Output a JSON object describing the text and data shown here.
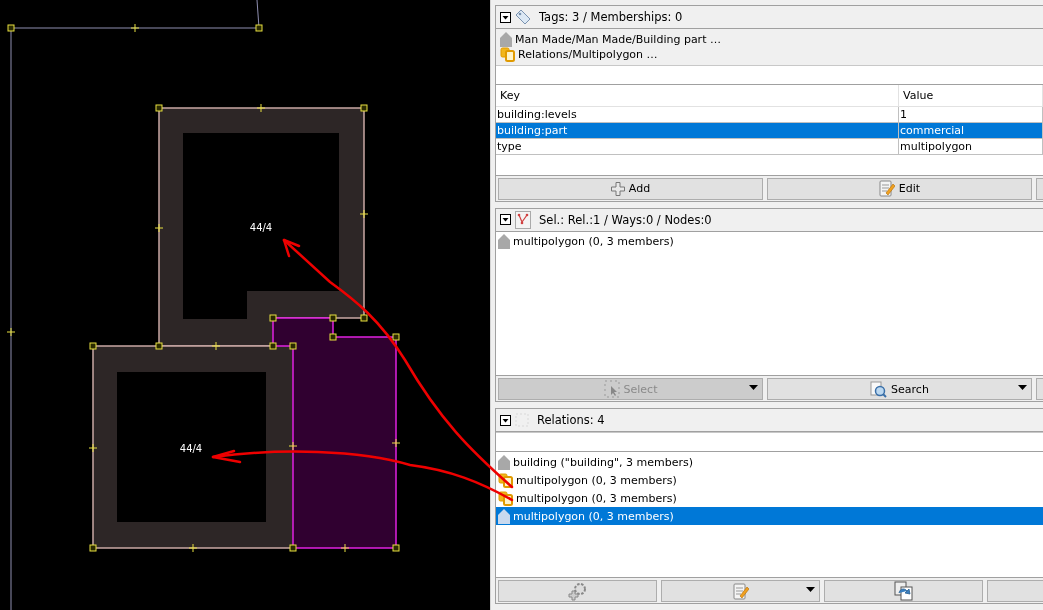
{
  "map": {
    "labels": [
      "44/4",
      "44/4"
    ]
  },
  "tags_panel": {
    "title": "Tags: 3 / Memberships: 0",
    "presets": [
      {
        "kind": "building",
        "label": "Man Made/Man Made/Building part …"
      },
      {
        "kind": "multipolygon",
        "label": "Relations/Multipolygon …"
      }
    ],
    "columns": [
      "Key",
      "Value"
    ],
    "rows": [
      {
        "key": "building:levels",
        "value": "1",
        "selected": false
      },
      {
        "key": "building:part",
        "value": "commercial",
        "selected": true
      },
      {
        "key": "type",
        "value": "multipolygon",
        "selected": false
      }
    ],
    "buttons": [
      {
        "kind": "plus",
        "label": "Add",
        "disabled": false,
        "dropdown": false
      },
      {
        "kind": "edit",
        "label": "Edit",
        "disabled": false,
        "dropdown": false
      }
    ]
  },
  "selection_panel": {
    "title": "Sel.: Rel.:1 / Ways:0 / Nodes:0",
    "items": [
      {
        "kind": "building",
        "label": "multipolygon (0, 3 members)",
        "selected": false
      }
    ],
    "buttons": [
      {
        "kind": "select",
        "label": "Select",
        "disabled": true,
        "dropdown": true
      },
      {
        "kind": "search",
        "label": "Search",
        "disabled": false,
        "dropdown": true
      }
    ]
  },
  "relations_panel": {
    "title": "Relations: 4",
    "items": [
      {
        "kind": "building",
        "label": "building (\"building\", 3 members)",
        "selected": false
      },
      {
        "kind": "multipolygon",
        "label": "multipolygon (0, 3 members)",
        "selected": false
      },
      {
        "kind": "multipolygon",
        "label": "multipolygon (0, 3 members)",
        "selected": false
      },
      {
        "kind": "building",
        "label": "multipolygon (0, 3 members)",
        "selected": true
      }
    ],
    "buttons": [
      {
        "kind": "gear",
        "disabled": false,
        "dropdown": false
      },
      {
        "kind": "edit",
        "disabled": false,
        "dropdown": true
      },
      {
        "kind": "duplicate",
        "disabled": false,
        "dropdown": false
      }
    ]
  }
}
